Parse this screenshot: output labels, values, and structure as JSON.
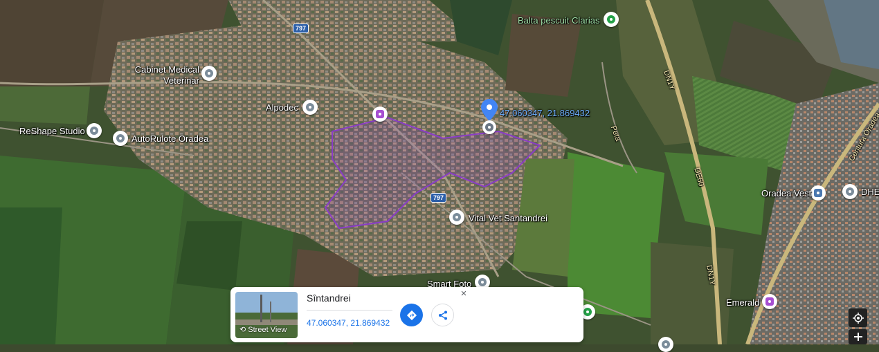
{
  "map": {
    "pin_coordinates": "47.060347, 21.869432",
    "places": [
      {
        "name": "Balta pescuit Clarias"
      },
      {
        "name": "Cabinet Medical\nVeterinar"
      },
      {
        "name": "Alpodec"
      },
      {
        "name": "ReShape Studio"
      },
      {
        "name": "AutoRulote Oradea"
      },
      {
        "name": "Vital Vet Santandrei"
      },
      {
        "name": "Smart Foto"
      },
      {
        "name": "Oradea Vest"
      },
      {
        "name": "Emerald"
      },
      {
        "name": "DHE"
      }
    ],
    "road_labels": [
      "DN1Y",
      "DN1Y",
      "DE60",
      "Peta",
      "Centura Oradea"
    ],
    "shields": [
      "797",
      "797"
    ]
  },
  "card": {
    "title": "Sîntandrei",
    "coordinates": "47.060347, 21.869432",
    "street_view_label": "Street View",
    "close_symbol": "×"
  },
  "colors": {
    "accent": "#1a73e8",
    "pin": "#4285f4",
    "boundary": "#8a3cc8"
  },
  "icons": {
    "directions": "directions-icon",
    "share": "share-icon",
    "close": "close-icon",
    "street_view": "street-view-icon",
    "location": "my-location-icon",
    "zoom_in": "zoom-in-icon"
  }
}
